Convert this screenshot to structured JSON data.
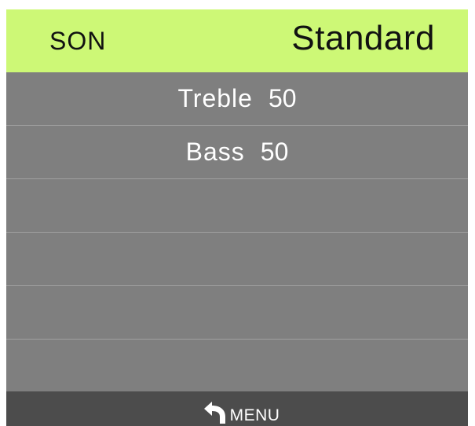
{
  "header": {
    "title": "SON",
    "mode": "Standard"
  },
  "settings": [
    {
      "label": "Treble",
      "value": "50"
    },
    {
      "label": "Bass",
      "value": "50"
    }
  ],
  "footer": {
    "back_label": "MENU",
    "back_icon": "return-arrow-icon"
  },
  "colors": {
    "header_bg": "#cdf876",
    "body_bg": "#7f7f7f",
    "footer_bg": "#4c4c4c",
    "text": "#ffffff"
  }
}
